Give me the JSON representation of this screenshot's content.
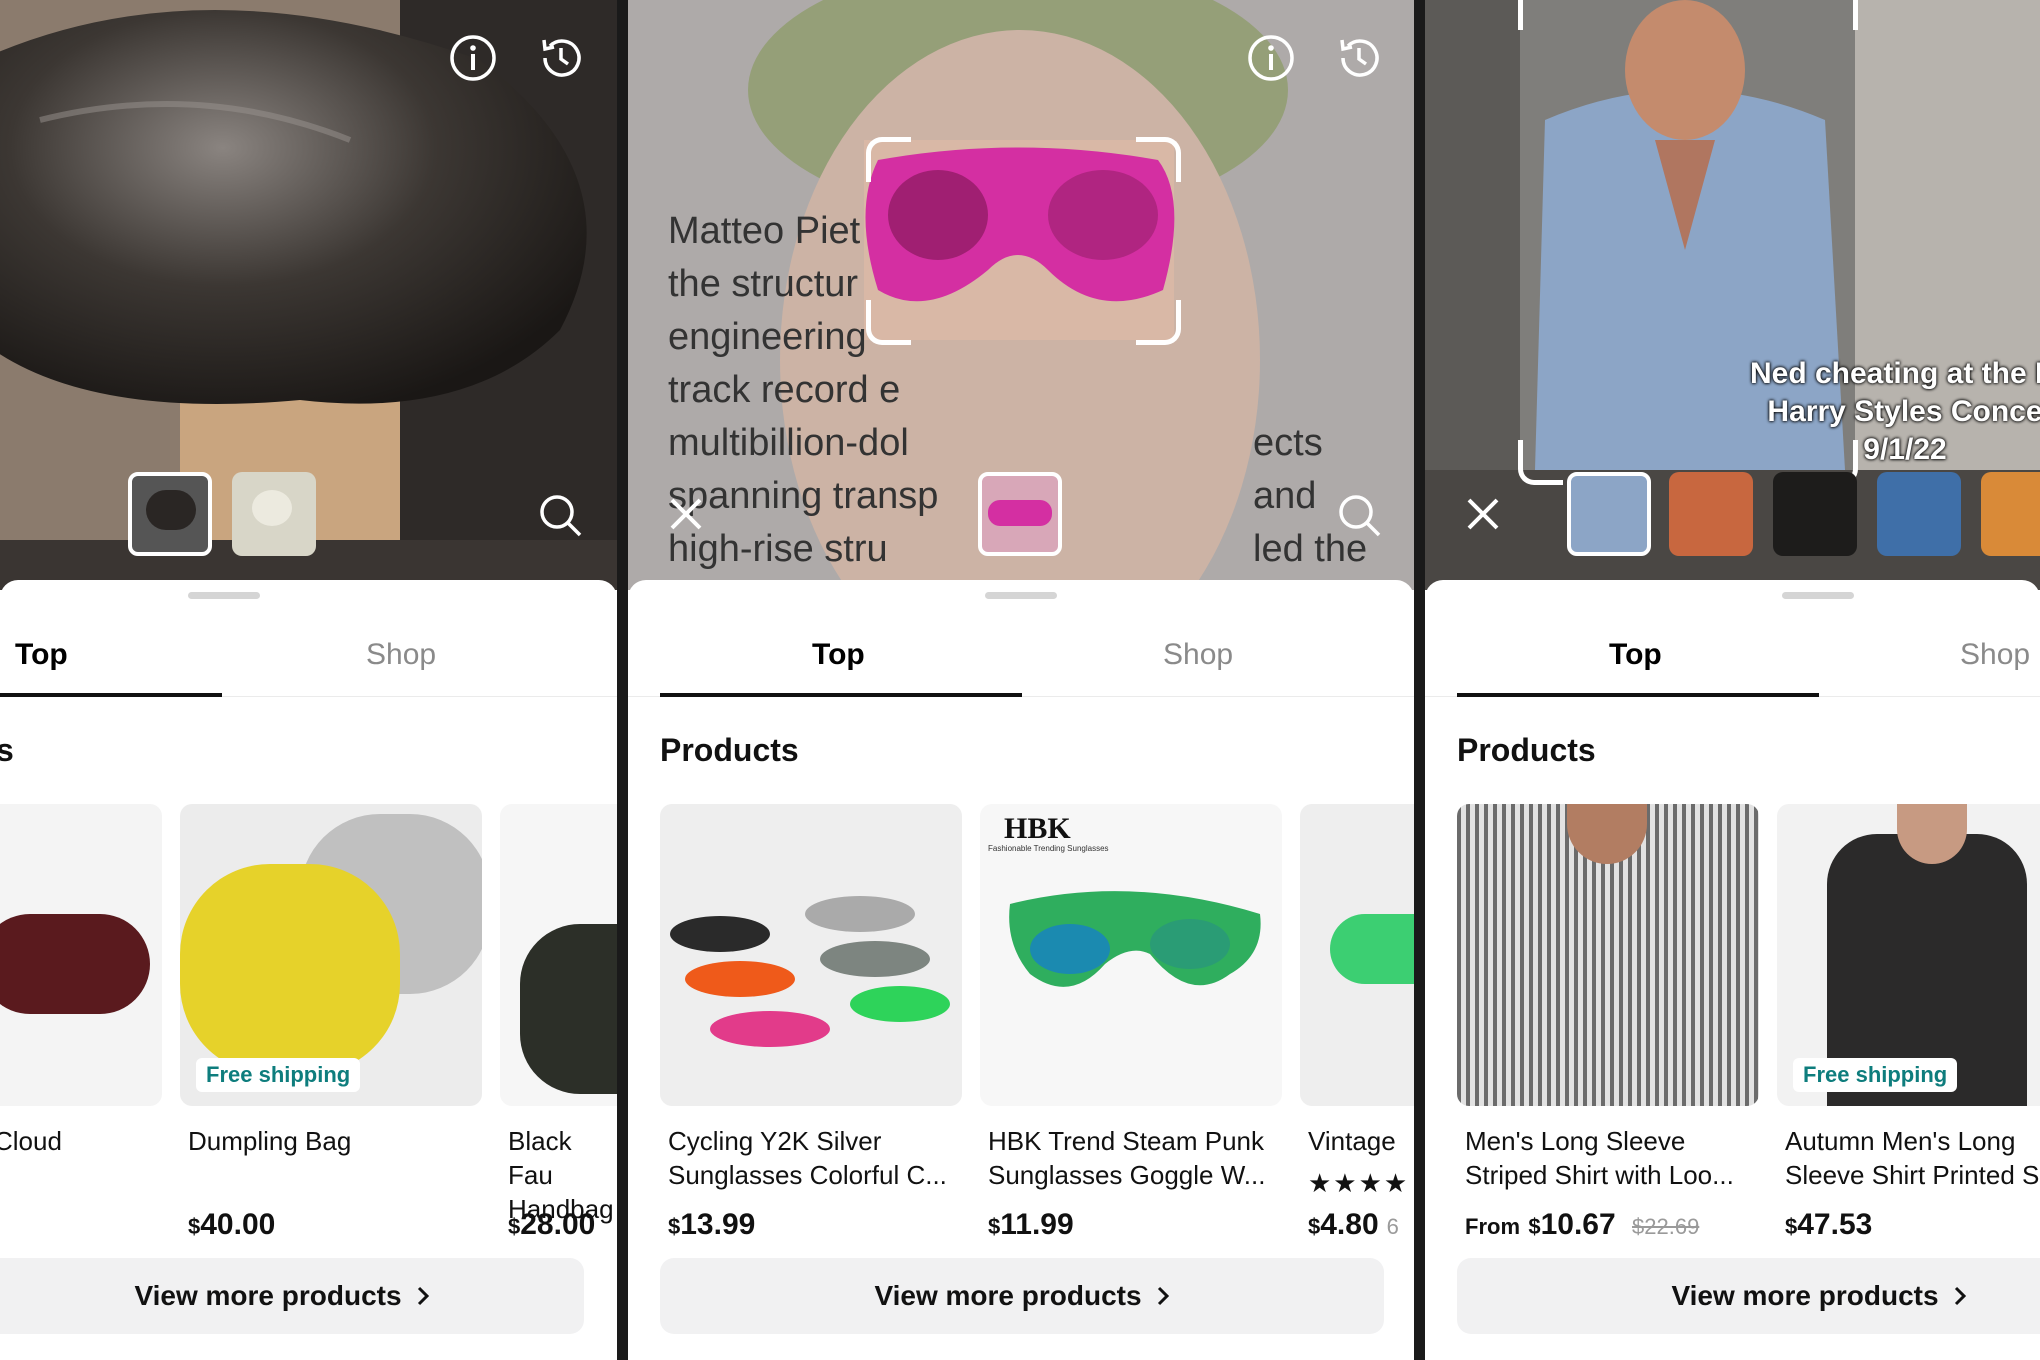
{
  "panels": [
    {
      "tabs": {
        "top": "Top",
        "shop": "Shop"
      },
      "section_title": "s",
      "products": [
        {
          "title": "Cloud",
          "price": ""
        },
        {
          "title": "Dumpling Bag",
          "price": "40.00",
          "badge": "Free shipping"
        },
        {
          "title": "Black Fau Handbag",
          "price": "28.00"
        }
      ],
      "view_more": "View more products"
    },
    {
      "overlay_text": [
        "Matteo Piet",
        "the structur",
        "engineering",
        "track record e",
        "multibillion-dol",
        "spanning transp",
        "high-rise stru"
      ],
      "overlay_text_right": [
        "ects",
        "and",
        "led the"
      ],
      "tabs": {
        "top": "Top",
        "shop": "Shop"
      },
      "section_title": "Products",
      "products": [
        {
          "title": "Cycling Y2K Silver Sunglasses Colorful C...",
          "price": "13.99"
        },
        {
          "title": "HBK Trend Steam Punk Sunglasses Goggle W...",
          "price": "11.99",
          "brand": "HBK",
          "brand_tagline": "Fashionable Trending Sunglasses"
        },
        {
          "title": "Vintage",
          "price": "4.80",
          "rating_stars": 4,
          "rating_suffix": "6"
        }
      ],
      "view_more": "View more products"
    },
    {
      "caption": [
        "Ned cheating at the M",
        "Harry Styles Conce",
        "9/1/22"
      ],
      "tabs": {
        "top": "Top",
        "shop": "Shop"
      },
      "section_title": "Products",
      "products": [
        {
          "title": "Men's Long Sleeve Striped Shirt with Loo...",
          "price_prefix": "From",
          "price": "10.67",
          "original_price": "$22.69"
        },
        {
          "title": "Autumn Men's Long Sleeve Shirt Printed S",
          "price": "47.53",
          "badge": "Free shipping"
        }
      ],
      "view_more": "View more products"
    }
  ],
  "currency": "$",
  "colors": {
    "accent_badge": "#0e7d7d",
    "sunglasses_pink": "#d42fa2",
    "button_bg": "#f1f1f2"
  },
  "icons": [
    "info-icon",
    "history-icon",
    "search-icon",
    "close-icon",
    "chevron-right-icon"
  ]
}
